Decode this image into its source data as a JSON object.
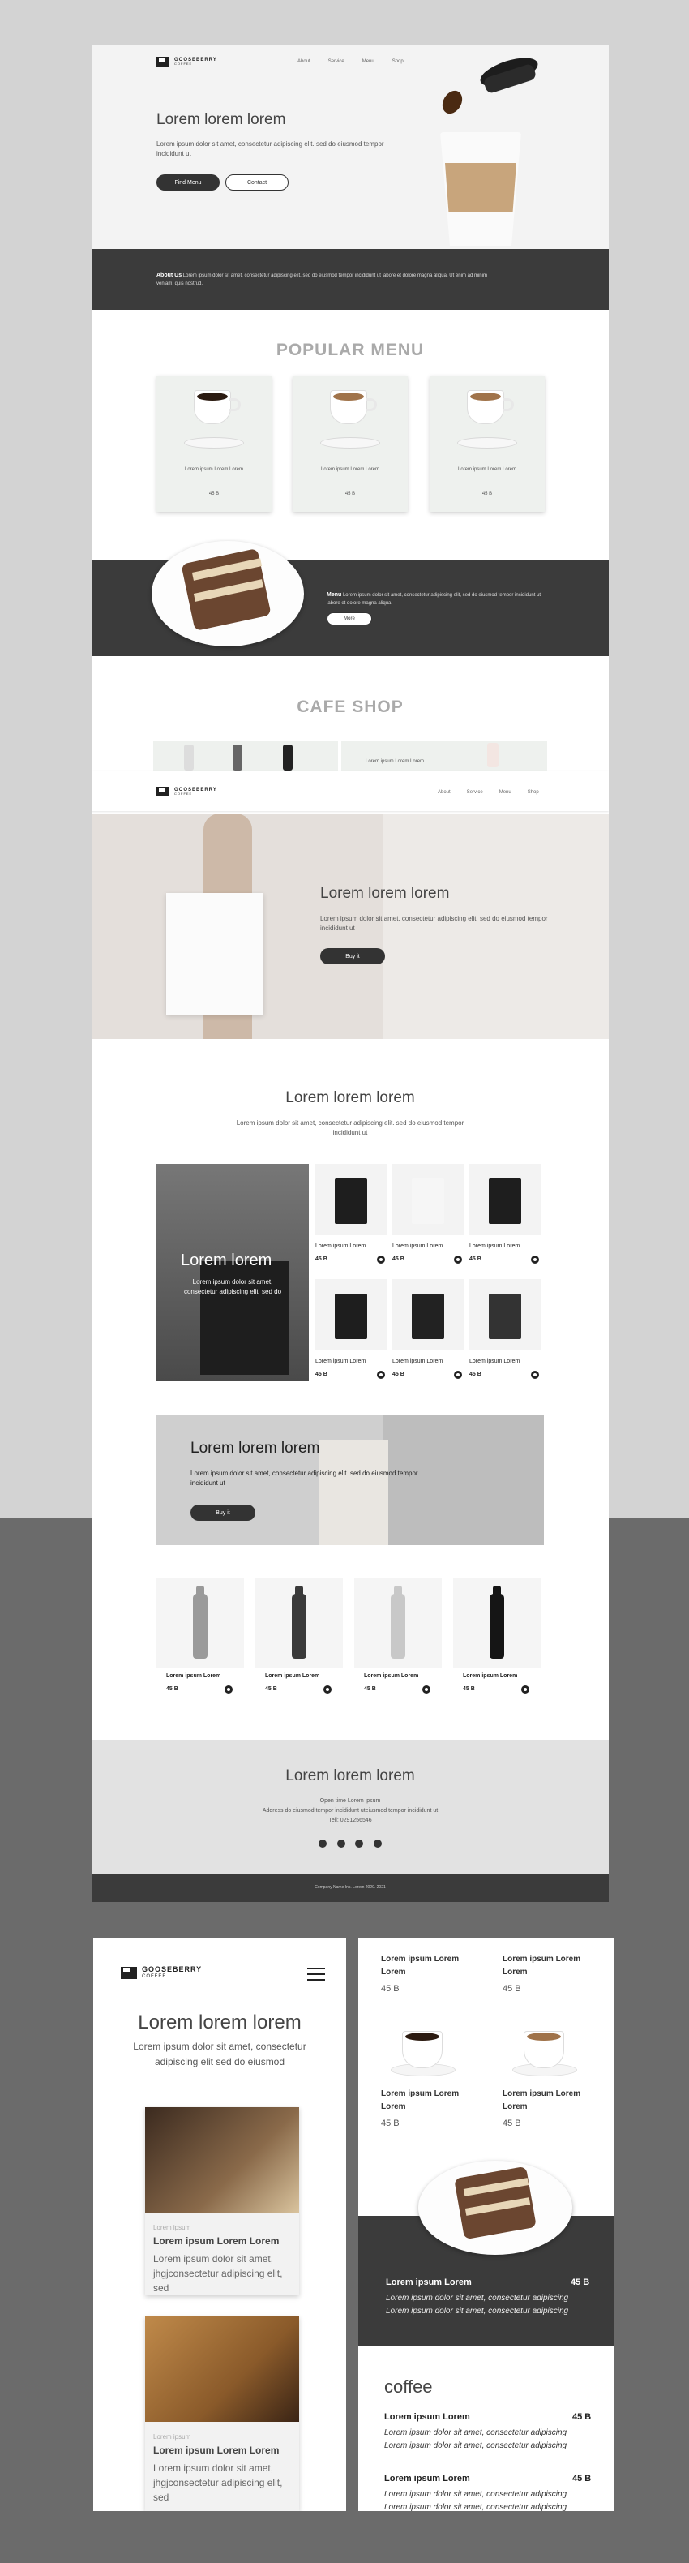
{
  "brand": {
    "name": "GOOSEBERRY",
    "tag": "COFFEE"
  },
  "nav": [
    "About",
    "Service",
    "Menu",
    "Shop"
  ],
  "hero": {
    "title": "Lorem lorem lorem",
    "text": "Lorem ipsum dolor sit amet, consectetur adipiscing elit. sed do eiusmod tempor incididunt ut",
    "btn_primary": "Find Menu",
    "btn_secondary": "Contact"
  },
  "about": {
    "label": "About Us",
    "text": "Lorem ipsum dolor sit amet, consectetur adipiscing elit, sed do eiusmod tempor incididunt ut labore et dolore magna aliqua. Ut enim ad minim veniam, quis nostrud."
  },
  "popular": {
    "title": "POPULAR MENU",
    "items": [
      {
        "name": "Lorem ipsum Lorem Lorem",
        "price": "45 B"
      },
      {
        "name": "Lorem ipsum Lorem Lorem",
        "price": "45 B"
      },
      {
        "name": "Lorem ipsum Lorem Lorem",
        "price": "45 B"
      }
    ]
  },
  "menu_band": {
    "label": "Menu",
    "text": "Lorem ipsum dolor sit amet, consectetur adipiscing elit, sed do eiusmod tempor incididunt ut labore et dolore magna aliqua.",
    "button": "More"
  },
  "cafe_shop": {
    "title": "CAFE SHOP",
    "caption": "Lorem ipsum Lorem Lorem"
  },
  "shop_hero": {
    "title": "Lorem lorem lorem",
    "text": "Lorem ipsum dolor sit amet, consectetur adipiscing elit. sed do eiusmod tempor incididunt ut",
    "button": "Buy it"
  },
  "shop_section": {
    "title": "Lorem lorem lorem",
    "text": "Lorem ipsum dolor sit amet, consectetur adipiscing elit. sed do eiusmod tempor incididunt ut"
  },
  "feature": {
    "title": "Lorem lorem",
    "text": "Lorem ipsum dolor sit amet, consectetur adipiscing elit. sed do"
  },
  "products": [
    {
      "name": "Lorem ipsum Lorem",
      "price": "45 B"
    },
    {
      "name": "Lorem ipsum Lorem",
      "price": "45 B"
    },
    {
      "name": "Lorem ipsum Lorem",
      "price": "45 B"
    },
    {
      "name": "Lorem ipsum Lorem",
      "price": "45 B"
    },
    {
      "name": "Lorem ipsum Lorem",
      "price": "45 B"
    },
    {
      "name": "Lorem ipsum Lorem",
      "price": "45 B"
    }
  ],
  "banner": {
    "title": "Lorem lorem lorem",
    "text": "Lorem ipsum dolor sit amet, consectetur adipiscing elit. sed do eiusmod tempor incididunt ut",
    "button": "Buy it"
  },
  "bottles": [
    {
      "name": "Lorem ipsum Lorem",
      "price": "45 B"
    },
    {
      "name": "Lorem ipsum Lorem",
      "price": "45 B"
    },
    {
      "name": "Lorem ipsum Lorem",
      "price": "45 B"
    },
    {
      "name": "Lorem ipsum Lorem",
      "price": "45 B"
    }
  ],
  "contact": {
    "title": "Lorem lorem lorem",
    "hours": "Open time Lorem ipsum",
    "address": "Address do eiusmod tempor incididunt uteiusmod tempor incididunt ut",
    "tel": "Tell: 0291256546"
  },
  "footer": {
    "text": "Company Name Inc. Lorem 2020. 2021"
  },
  "mobile_left": {
    "title": "Lorem lorem lorem",
    "text": "Lorem ipsum dolor sit amet, consectetur adipiscing elit  sed do eiusmod",
    "cards": [
      {
        "tag": "Lorem ipsum",
        "title": "Lorem ipsum Lorem Lorem",
        "text": "Lorem ipsum dolor sit amet, jhgjconsectetur adipiscing elit, sed"
      },
      {
        "tag": "Lorem ipsum",
        "title": "Lorem ipsum Lorem Lorem",
        "text": "Lorem ipsum dolor sit amet, jhgjconsectetur adipiscing elit, sed"
      }
    ]
  },
  "mobile_right": {
    "top_items": [
      {
        "name": "Lorem ipsum Lorem Lorem",
        "price": "45 B"
      },
      {
        "name": "Lorem ipsum Lorem Lorem",
        "price": "45 B"
      },
      {
        "name": "Lorem ipsum Lorem Lorem",
        "price": "45 B"
      },
      {
        "name": "Lorem ipsum Lorem Lorem",
        "price": "45 B"
      }
    ],
    "dark_item": {
      "name": "Lorem ipsum Lorem",
      "price": "45 B",
      "text1": "Lorem ipsum dolor sit amet, consectetur adipiscing",
      "text2": "Lorem ipsum dolor sit amet, consectetur adipiscing"
    },
    "coffee_title": "coffee",
    "coffee_items": [
      {
        "name": "Lorem ipsum Lorem",
        "price": "45 B",
        "text1": "Lorem ipsum dolor sit amet, consectetur adipiscing",
        "text2": "Lorem ipsum dolor sit amet, consectetur adipiscing"
      },
      {
        "name": "Lorem ipsum Lorem",
        "price": "45 B",
        "text1": "Lorem ipsum dolor sit amet, consectetur adipiscing",
        "text2": "Lorem ipsum dolor sit amet, consectetur adipiscing"
      }
    ]
  }
}
